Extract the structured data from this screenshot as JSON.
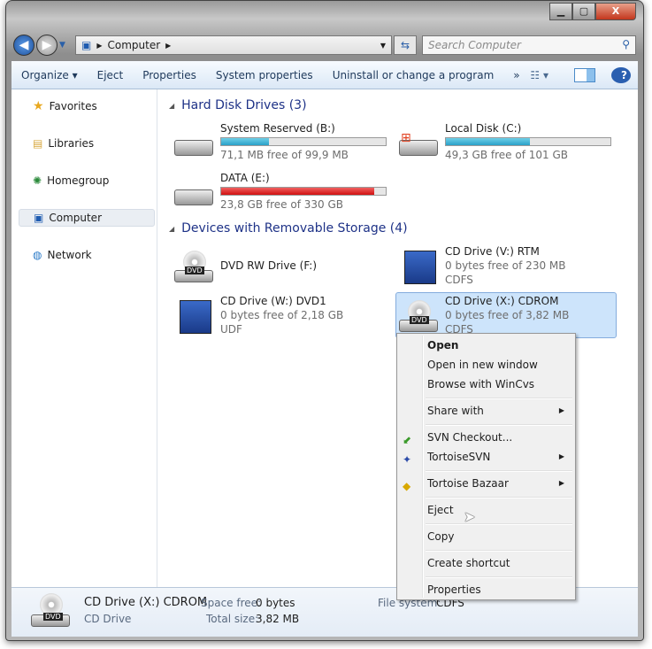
{
  "window": {
    "controls": {
      "minimize": "▁",
      "maximize": "▢",
      "close": "X"
    }
  },
  "address": {
    "path": [
      "Computer"
    ],
    "search_placeholder": "Search Computer"
  },
  "toolbar": {
    "items": [
      "Organize ▾",
      "Eject",
      "Properties",
      "System properties",
      "Uninstall or change a program",
      "»"
    ]
  },
  "sidebar": {
    "items": [
      {
        "label": "Favorites",
        "icon": "star-icon"
      },
      {
        "label": "Libraries",
        "icon": "libraries-icon"
      },
      {
        "label": "Homegroup",
        "icon": "homegroup-icon"
      },
      {
        "label": "Computer",
        "icon": "computer-icon",
        "selected": true
      },
      {
        "label": "Network",
        "icon": "network-icon"
      }
    ]
  },
  "groups": {
    "hdd": "Hard Disk Drives (3)",
    "removable": "Devices with Removable Storage (4)"
  },
  "drives": [
    {
      "name": "System Reserved (B:)",
      "sub": "71,1 MB free of 99,9 MB",
      "used_pct": 29
    },
    {
      "name": "Local Disk (C:)",
      "sub": "49,3 GB free of 101 GB",
      "used_pct": 51
    },
    {
      "name": "DATA (E:)",
      "sub": "23,8 GB free of 330 GB",
      "used_pct": 93
    },
    {
      "name": "DVD RW Drive (F:)"
    },
    {
      "name": "CD Drive (V:) RTM",
      "sub": "0 bytes free of 230 MB",
      "fs": "CDFS"
    },
    {
      "name": "CD Drive (W:) DVD1",
      "sub": "0 bytes free of 2,18 GB",
      "fs": "UDF"
    },
    {
      "name": "CD Drive (X:) CDROM",
      "sub": "0 bytes free of 3,82 MB",
      "fs": "CDFS"
    }
  ],
  "context_menu": {
    "items": [
      "Open",
      "Open in new window",
      "Browse with WinCvs",
      "Share with",
      "SVN Checkout...",
      "TortoiseSVN",
      "Tortoise Bazaar",
      "Eject",
      "Copy",
      "Create shortcut",
      "Properties"
    ]
  },
  "status": {
    "name": "CD Drive (X:) CDROM",
    "type": "CD Drive",
    "space_free_label": "Space free:",
    "space_free": "0 bytes",
    "total_size_label": "Total size:",
    "total_size": "3,82 MB",
    "fs_label": "File system:",
    "fs": "CDFS"
  },
  "colors": {
    "bar": "#2aa0c8",
    "bar_full": "#d01010",
    "selection": "#cde4fb",
    "group_heading": "#1e3287"
  }
}
